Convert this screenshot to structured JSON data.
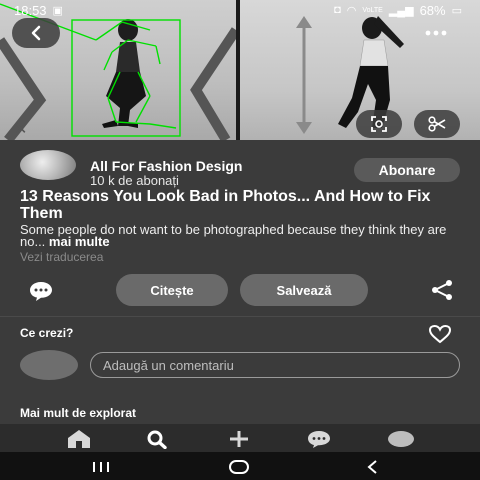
{
  "status_bar": {
    "time": "18:53",
    "battery": "68%",
    "net_label": "VoLTE"
  },
  "hero": {
    "back_icon": "chevron-left-icon",
    "more_icon": "more-dots-icon",
    "lens_icon": "visual-search-icon",
    "scissor_icon": "scissors-icon"
  },
  "author": {
    "name": "All For Fashion Design",
    "followers": "10 k de abonați",
    "follow_label": "Abonare"
  },
  "pin": {
    "title": "13 Reasons You Look Bad in Photos... And How to Fix Them",
    "description": "Some people do not want to be photographed because they think they are no...",
    "more": "mai multe",
    "translate": "Vezi traducerea"
  },
  "actions": {
    "read_label": "Citește",
    "save_label": "Salvează"
  },
  "comments": {
    "heading": "Ce crezi?",
    "placeholder": "Adaugă un comentariu"
  },
  "explore": {
    "heading": "Mai mult de explorat"
  },
  "tab_bar": {
    "items": [
      "home-icon",
      "search-icon",
      "add-icon",
      "messages-icon",
      "profile-icon"
    ]
  },
  "nav_bar": {
    "items": [
      "recents-icon",
      "home-circle-icon",
      "back-icon"
    ]
  },
  "colors": {
    "background": "#3b3b3b",
    "button": "#6a6a6a",
    "overlay_lines": "#00e000"
  }
}
